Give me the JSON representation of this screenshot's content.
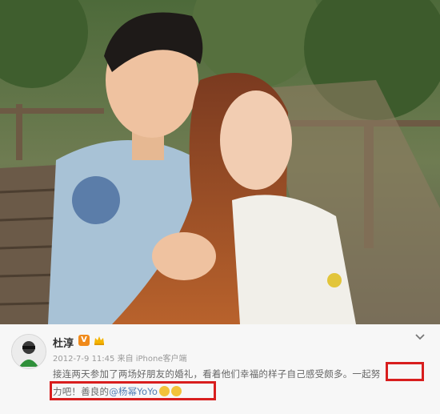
{
  "post": {
    "username": "杜淳",
    "verified_badge": "V",
    "timestamp_source": "2012-7-9 11:45 来自 iPhone客户端",
    "text_line1": "接连两天参加了两场好朋友的婚礼，看着他们幸福的样子自己感受颇多。一起努",
    "text_line2_prefix": "力吧！善良的",
    "text_line2_mention": "@杨幂YoYo",
    "icons": {
      "avatar": "avatar-icon",
      "crown": "crown-icon",
      "chevron": "chevron-down-icon",
      "emoji": "emoji-icon"
    }
  },
  "colors": {
    "highlight": "#d81e1e",
    "mention": "#4f7cb3",
    "badge": "#f08a1a"
  }
}
